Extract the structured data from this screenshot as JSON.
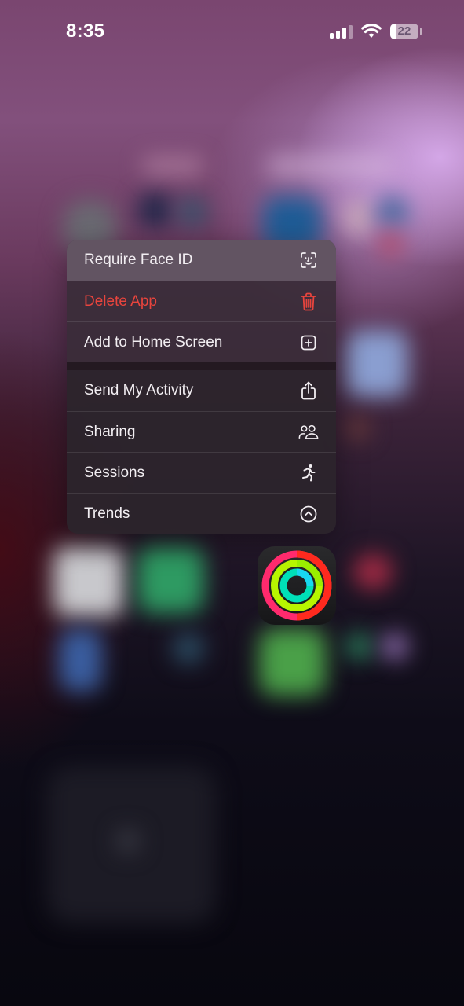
{
  "status_bar": {
    "time": "8:35",
    "battery_level": "22",
    "battery_fraction": 0.22,
    "signal_bars_active": 3,
    "signal_bars_total": 4
  },
  "context_menu": {
    "primary_actions": [
      {
        "label": "Require Face ID",
        "icon": "face-id-icon",
        "highlighted": true
      },
      {
        "label": "Delete App",
        "icon": "trash-icon",
        "destructive": true
      },
      {
        "label": "Add to Home Screen",
        "icon": "plus-square-icon"
      }
    ],
    "app_actions": [
      {
        "label": "Send My Activity",
        "icon": "share-icon"
      },
      {
        "label": "Sharing",
        "icon": "people-icon"
      },
      {
        "label": "Sessions",
        "icon": "running-figure-icon"
      },
      {
        "label": "Trends",
        "icon": "chevron-up-circle-icon"
      }
    ]
  },
  "app": {
    "name": "Fitness",
    "icon": "activity-rings-icon",
    "ring_colors": [
      "#ff2a6d",
      "#b7f500",
      "#00e0e8"
    ]
  },
  "colors": {
    "destructive": "#e8443d",
    "text": "#f2eef2"
  }
}
